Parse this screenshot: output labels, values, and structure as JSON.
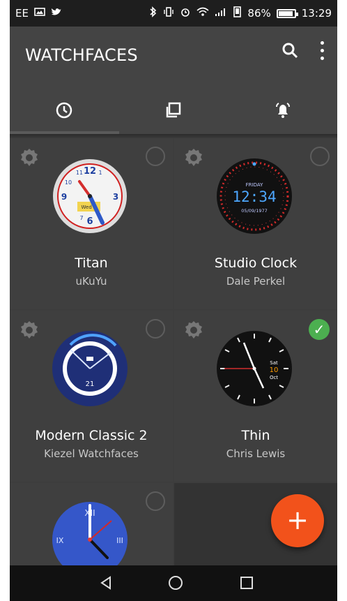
{
  "status_bar": {
    "carrier": "EE",
    "battery_percent": "86%",
    "time": "13:29"
  },
  "app_bar": {
    "title": "WATCHFACES",
    "icons": [
      "search-icon",
      "more-vert-icon"
    ]
  },
  "tabs": [
    {
      "icon": "clock-icon"
    },
    {
      "icon": "copy-icon"
    },
    {
      "icon": "alarm-icon"
    }
  ],
  "watchfaces": [
    {
      "name": "Titan",
      "author": "uKuYu",
      "selected": false,
      "face_text": {
        "numbers": [
          "11",
          "12",
          "1",
          "10",
          "9",
          "3",
          "7",
          "6"
        ],
        "date": "Wed 7"
      }
    },
    {
      "name": "Studio Clock",
      "author": "Dale Perkel",
      "selected": false,
      "face_text": {
        "day": "FRIDAY",
        "time": "12:34",
        "date": "05/09/1977"
      }
    },
    {
      "name": "Modern Classic 2",
      "author": "Kiezel Watchfaces",
      "selected": false,
      "face_text": {
        "date": "21"
      }
    },
    {
      "name": "Thin",
      "author": "Chris Lewis",
      "selected": true,
      "face_text": {
        "day": "Sat",
        "date": "10",
        "month": "Oct"
      }
    },
    {
      "name": "",
      "author": "",
      "selected": false,
      "face_text": {
        "numbers": [
          "XII",
          "IX",
          "III"
        ]
      }
    }
  ],
  "fab": {
    "label": "+"
  },
  "nav_bar": {
    "icons": [
      "back-icon",
      "home-icon",
      "recent-apps-icon"
    ]
  },
  "colors": {
    "app_bar": "#444444",
    "background": "#3b3b3b",
    "accent": "#f2521b",
    "selected": "#4CAF50"
  }
}
